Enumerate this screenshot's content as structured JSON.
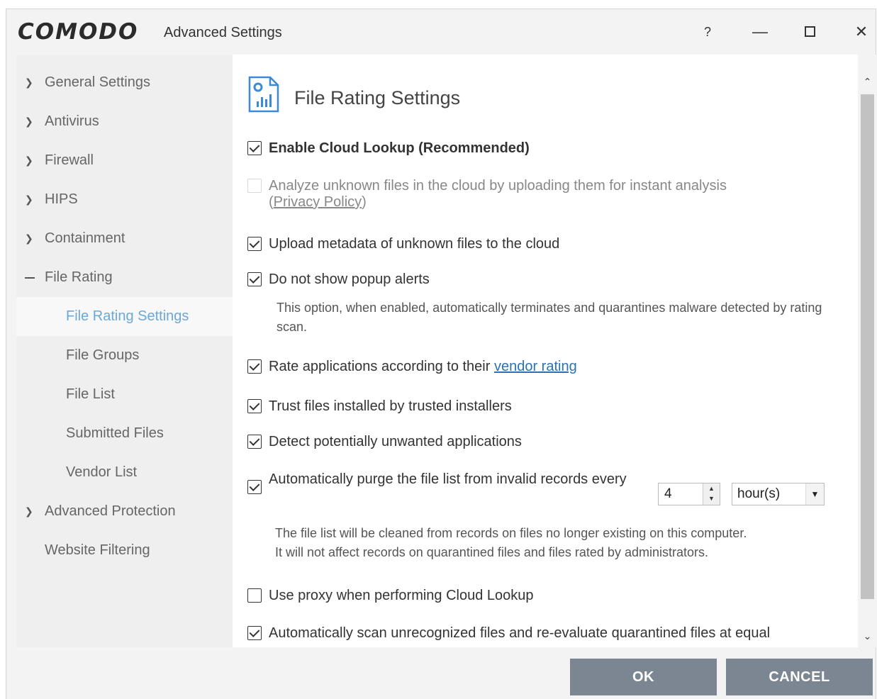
{
  "window": {
    "logo": "COMODO",
    "title": "Advanced Settings",
    "help": "?",
    "minimize": "—",
    "close": "✕"
  },
  "sidebar": {
    "items": [
      {
        "label": "General Settings",
        "expanded": false
      },
      {
        "label": "Antivirus",
        "expanded": false
      },
      {
        "label": "Firewall",
        "expanded": false
      },
      {
        "label": "HIPS",
        "expanded": false
      },
      {
        "label": "Containment",
        "expanded": false
      },
      {
        "label": "File Rating",
        "expanded": true
      },
      {
        "label": "File Rating Settings",
        "active": true
      },
      {
        "label": "File Groups"
      },
      {
        "label": "File List"
      },
      {
        "label": "Submitted Files"
      },
      {
        "label": "Vendor List"
      },
      {
        "label": "Advanced Protection",
        "expanded": false
      },
      {
        "label": "Website Filtering"
      }
    ]
  },
  "content": {
    "title": "File Rating Settings",
    "options": {
      "cloud_lookup": {
        "label": "Enable Cloud Lookup (Recommended)",
        "checked": true
      },
      "analyze_unknown": {
        "label": "Analyze unknown files in the cloud by uploading them for instant analysis",
        "privacy_open": "(",
        "privacy_link": "Privacy Policy",
        "privacy_close": ")",
        "checked": false,
        "disabled": true
      },
      "upload_metadata": {
        "label": "Upload metadata of unknown files to the cloud",
        "checked": true
      },
      "no_popup": {
        "label": "Do not show popup alerts",
        "checked": true,
        "desc": "This option, when enabled, automatically terminates and quarantines malware detected by rating scan."
      },
      "rate_vendor": {
        "label": "Rate applications according to their ",
        "link": "vendor rating",
        "checked": true
      },
      "trust_installers": {
        "label": "Trust files installed by trusted installers",
        "checked": true
      },
      "detect_pua": {
        "label": "Detect potentially unwanted applications",
        "checked": true
      },
      "auto_purge": {
        "label": "Automatically purge the file list from invalid records every",
        "checked": true,
        "value": "4",
        "unit": "hour(s)",
        "desc1": "The file list will be cleaned from records on files no longer existing on this computer.",
        "desc2": "It will not affect records on quarantined files and files rated by administrators."
      },
      "use_proxy": {
        "label": "Use proxy when performing Cloud Lookup",
        "checked": false
      },
      "auto_scan": {
        "label": "Automatically scan unrecognized files and re-evaluate quarantined files at equal",
        "checked": true
      }
    }
  },
  "footer": {
    "ok": "OK",
    "cancel": "CANCEL"
  }
}
